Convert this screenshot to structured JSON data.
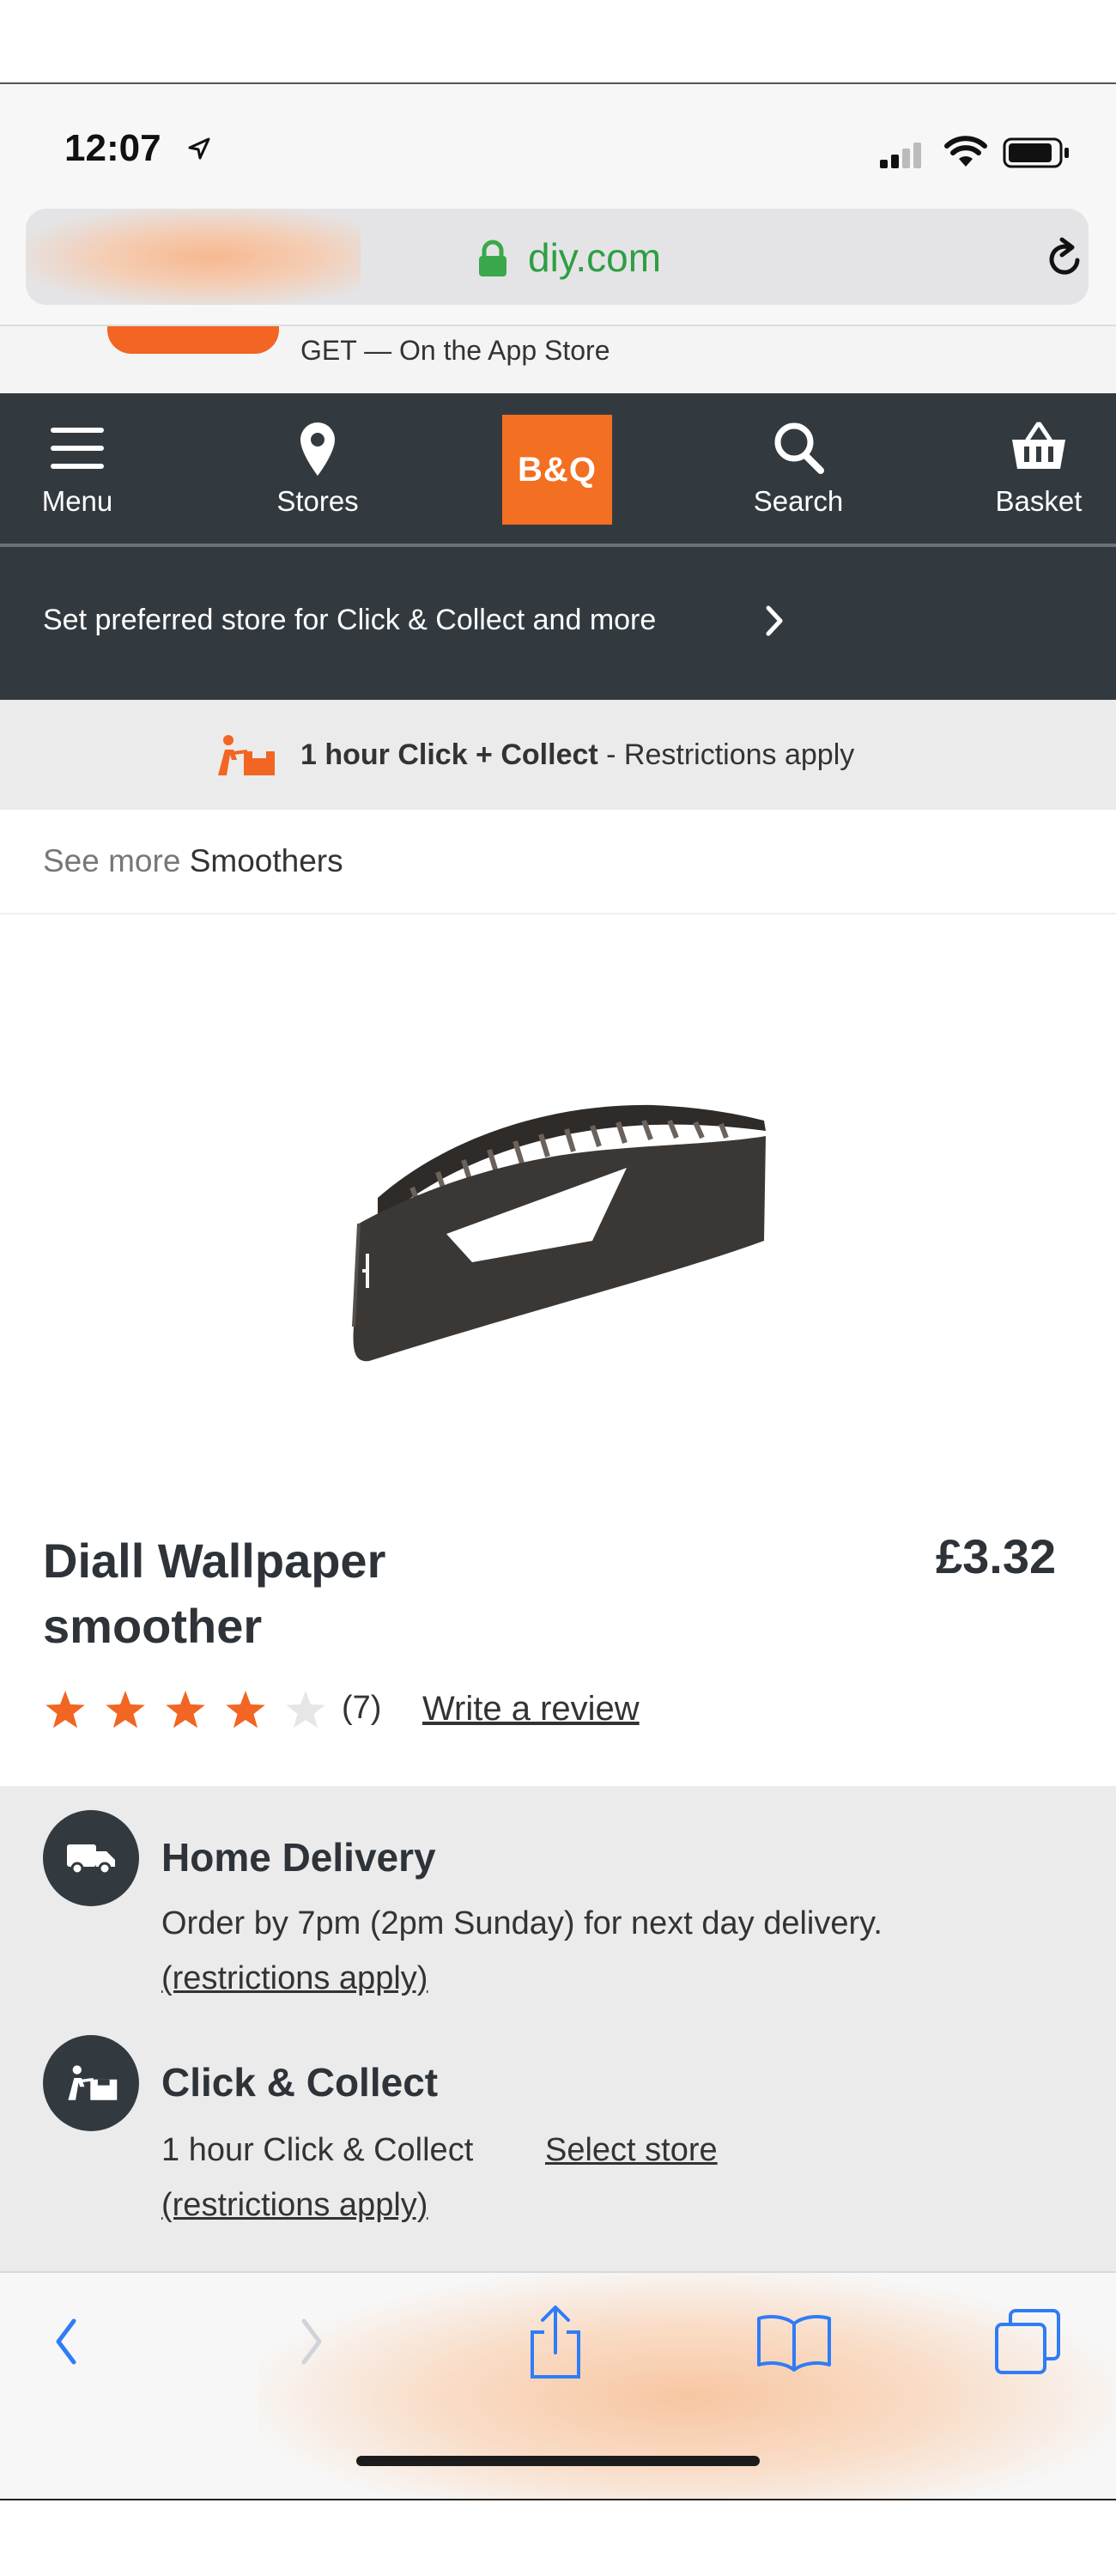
{
  "status_bar": {
    "time": "12:07"
  },
  "browser": {
    "url": "diy.com"
  },
  "app_banner": {
    "text": "GET — On the App Store"
  },
  "header": {
    "menu_label": "Menu",
    "stores_label": "Stores",
    "logo_text": "B&Q",
    "search_label": "Search",
    "basket_label": "Basket"
  },
  "store_bar": {
    "text": "Set preferred store for Click & Collect and more"
  },
  "cc_banner": {
    "bold": "1 hour Click + Collect",
    "rest": " - Restrictions apply"
  },
  "breadcrumb": {
    "prefix": "See more ",
    "category": "Smoothers"
  },
  "product": {
    "title_line1": "Diall Wallpaper",
    "title_line2": "smoother",
    "price": "£3.32",
    "rating": 4,
    "rating_max": 5,
    "review_count": "(7)",
    "write_review": "Write a review"
  },
  "delivery": {
    "home_title": "Home Delivery",
    "home_text": "Order by 7pm (2pm Sunday) for next day delivery.",
    "home_restrictions": "(restrictions apply)",
    "cc_title": "Click & Collect",
    "cc_text": "1 hour Click & Collect",
    "cc_select": "Select store",
    "cc_restrictions": "(restrictions apply)"
  },
  "colors": {
    "brand_orange": "#f36f21",
    "header_dark": "#333a3f",
    "star_filled": "#f26522",
    "star_empty": "#e6e6e6",
    "safari_blue": "#2f7cf6"
  }
}
